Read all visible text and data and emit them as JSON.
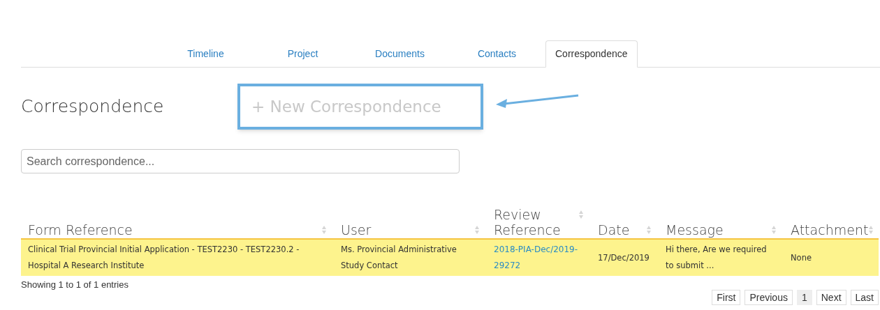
{
  "tabs": [
    {
      "label": "Timeline",
      "selected": false
    },
    {
      "label": "Project",
      "selected": false
    },
    {
      "label": "Documents",
      "selected": false
    },
    {
      "label": "Contacts",
      "selected": false
    },
    {
      "label": "Correspondence",
      "selected": true
    }
  ],
  "heading": "Correspondence",
  "new_button": {
    "label": "+ New Correspondence",
    "highlighted": true
  },
  "search": {
    "placeholder": "Search correspondence..."
  },
  "table": {
    "columns": [
      "Form Reference",
      "User",
      "Review Reference",
      "Date",
      "Message",
      "Attachment"
    ],
    "rows": [
      {
        "selected": true,
        "cells": [
          {
            "kind": "text",
            "text": "Clinical Trial Provincial Initial Application - TEST2230 - TEST2230.2 - Hospital A Research Institute"
          },
          {
            "kind": "text",
            "text": "Ms. Provincial Administrative Study Contact"
          },
          {
            "kind": "link",
            "text": "2018-PIA-Dec/2019-29272"
          },
          {
            "kind": "text",
            "text": "17/Dec/2019"
          },
          {
            "kind": "text",
            "text": "Hi there, Are we required to submit ..."
          },
          {
            "kind": "text",
            "text": "None"
          }
        ]
      }
    ]
  },
  "info": "Showing 1 to 1 of 1 entries",
  "pagination": [
    {
      "label": "First",
      "selected": false
    },
    {
      "label": "Previous",
      "selected": false
    },
    {
      "label": "1",
      "selected": true
    },
    {
      "label": "Next",
      "selected": false
    },
    {
      "label": "Last",
      "selected": false
    }
  ]
}
